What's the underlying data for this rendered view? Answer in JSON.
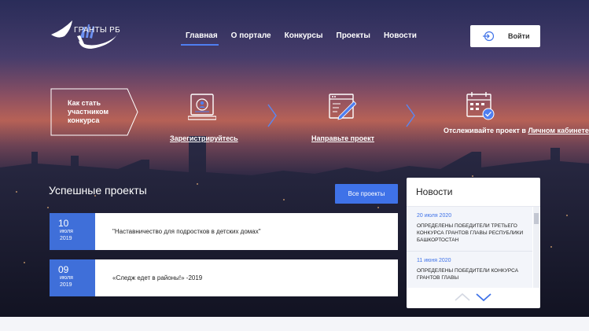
{
  "logo": {
    "text": "ГРАНТЫ РБ"
  },
  "nav": {
    "items": [
      {
        "label": "Главная"
      },
      {
        "label": "О портале"
      },
      {
        "label": "Конкурсы"
      },
      {
        "label": "Проекты"
      },
      {
        "label": "Новости"
      }
    ],
    "active_index": 0
  },
  "login": {
    "label": "Войти"
  },
  "steps": {
    "intro": "Как стать участником конкурса",
    "register": "Зарегистрируйтесь",
    "submit": "Направьте проект",
    "track_prefix": "Отслеживайте проект в ",
    "track_link": "Личном кабинете"
  },
  "projects": {
    "title": "Успешные проекты",
    "all_button": "Все проекты",
    "items": [
      {
        "day": "10",
        "month": "июля",
        "year": "2019",
        "name": "\"Наставничество для подростков в детских домах\""
      },
      {
        "day": "09",
        "month": "июля",
        "year": "2019",
        "name": "«Следж едет в районы!» -2019"
      }
    ]
  },
  "news": {
    "title": "Новости",
    "items": [
      {
        "date": "20 июля 2020",
        "text": "Определены победители третьего конкурса грантов Главы Республики Башкортостан"
      },
      {
        "date": "11 июня 2020",
        "text": "Определены победители конкурса грантов Главы"
      }
    ]
  },
  "colors": {
    "accent": "#3f72e8",
    "date_bg": "#3f6fd9"
  }
}
